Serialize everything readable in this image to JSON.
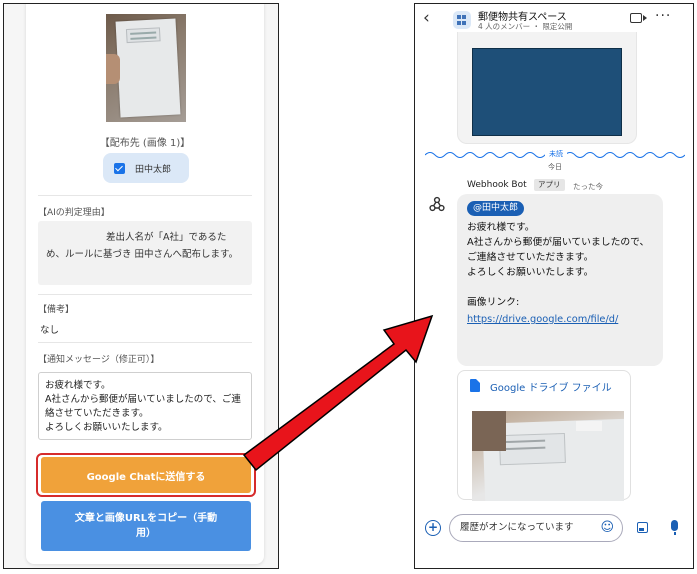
{
  "left": {
    "destination_label": "【配布先 (画像 1)】",
    "recipient_name": "田中太郎",
    "ai_reason_label": "【AIの判定理由】",
    "ai_reason_text": "差出人名が「A社」であるため、ルールに基づき 田中さんへ配布します。",
    "note_label": "【備考】",
    "note_value": "なし",
    "message_label": "【通知メッセージ（修正可）】",
    "message_text": "お疲れ様です。\nA社さんから郵便が届いていましたので、ご連絡させていただきます。\nよろしくお願いいたします。",
    "send_button": "Google Chatに送信する",
    "copy_button": "文章と画像URLをコピー（手動用）"
  },
  "right": {
    "space_title": "郵便物共有スペース",
    "space_subtitle": "4 人のメンバー ・ 限定公開",
    "back_icon": "‹",
    "more_icon": "···",
    "unread_label": "未読",
    "today_label": "今日",
    "bot_name": "Webhook Bot",
    "app_badge": "アプリ",
    "time": "たった今",
    "mention": "@田中太郎",
    "message_body": "お疲れ様です。\nA社さんから郵便が届いていましたので、ご連絡させていただきます。\nよろしくお願いいたします。\n\n画像リンク:",
    "link": "https://drive.google.com/file/d/",
    "drive_title": "Google ドライブ ファイル",
    "compose_placeholder": "履歴がオンになっています",
    "plus_icon": "+",
    "smiley_icon": "☺"
  },
  "colors": {
    "send_button": "#f0a23a",
    "copy_button": "#4a90e2",
    "highlight": "#d62b2b",
    "arrow": "#e8141b",
    "accent": "#1a5fb4"
  }
}
